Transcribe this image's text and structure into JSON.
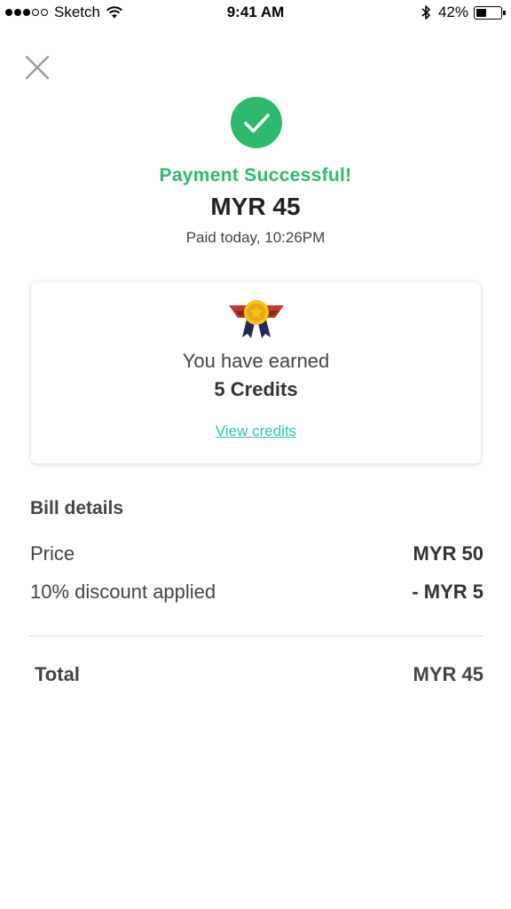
{
  "status_bar": {
    "carrier": "Sketch",
    "time": "9:41 AM",
    "battery_percent": "42%",
    "battery_level": 0.42,
    "signal_bars_filled": 3,
    "signal_bars_total": 5
  },
  "icons": {
    "close": "close-icon",
    "success": "check-circle-icon",
    "medal": "medal-icon"
  },
  "colors": {
    "success_green": "#2dba6f",
    "link_teal": "#2ec4b6",
    "medal_red": "#c0392b",
    "medal_gold": "#f5c518",
    "medal_navy": "#1f2a5a"
  },
  "payment": {
    "title": "Payment Successful!",
    "amount": "MYR 45",
    "paid_time": "Paid today, 10:26PM"
  },
  "credits_card": {
    "earned_label": "You have earned",
    "credits": "5 Credits",
    "view_link": "View credits"
  },
  "bill": {
    "heading": "Bill details",
    "rows": [
      {
        "label": "Price",
        "value": "MYR 50"
      },
      {
        "label": "10% discount applied",
        "value": "- MYR 5"
      }
    ],
    "total_label": "Total",
    "total_value": "MYR 45"
  }
}
